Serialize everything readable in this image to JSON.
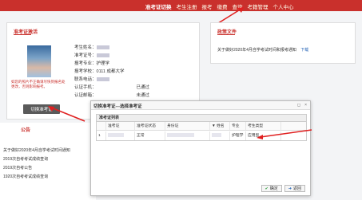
{
  "nav": {
    "items": [
      {
        "label": "准考证切换",
        "active": true
      },
      {
        "label": "考生注册",
        "active": false
      },
      {
        "label": "报考",
        "active": false
      },
      {
        "label": "缴费",
        "active": false
      },
      {
        "label": "查询",
        "active": false
      },
      {
        "label": "考籍管理",
        "active": false
      },
      {
        "label": "个人中心",
        "active": false
      }
    ]
  },
  "ticket_panel": {
    "title": "准考证激活",
    "warning": "如您的照片不正确请尽快到报名处更改，否则影响报考。",
    "switch_button": "切换准考证",
    "rows": [
      {
        "label": "考生姓名："
      },
      {
        "label": "准考证号："
      },
      {
        "label": "报考专业：",
        "value": "护理学"
      },
      {
        "label": "报考学校：",
        "value": "0111 成都大学"
      },
      {
        "label": "联系电话："
      },
      {
        "label": "认证手机："
      },
      {
        "label": "认证邮箱："
      }
    ],
    "side_text_1": "已通过",
    "side_text_2": "未通过"
  },
  "policy_panel": {
    "title": "政策文件",
    "notice": "关于做好2020年4月自学考试时间和报考通知",
    "download": "下载"
  },
  "bulletin": {
    "title": "公告",
    "items": [
      "关于做好2020年4月自学考试时间通知",
      "2019次自考考试成绩查询",
      "2019次自考公告",
      "1920次自考考试成绩查询"
    ]
  },
  "modal": {
    "title": "切换准考证---选择准考证",
    "list_title": "准考证列表",
    "columns": [
      "",
      "准考证",
      "准考证状态",
      "身份证",
      "姓名",
      "专业",
      "考生类型"
    ],
    "row": {
      "index": "1",
      "status": "正常",
      "major": "护理学",
      "type": "应用型"
    },
    "confirm": "确定",
    "back": "返回"
  }
}
